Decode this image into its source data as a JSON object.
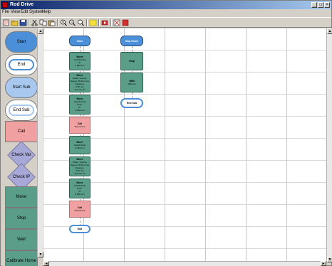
{
  "window": {
    "title": "Rod Drive"
  },
  "menu": [
    "File",
    "View",
    "Edit",
    "System",
    "Help"
  ],
  "toolbar": {
    "buttons": [
      "new-icon",
      "open-icon",
      "save-icon",
      "cut-icon",
      "copy-icon",
      "paste-icon",
      "zoom-in-icon",
      "zoom-out-icon",
      "zoom-fit-icon",
      "highlight-icon",
      "run-icon",
      "stop-icon"
    ]
  },
  "palette": {
    "items": [
      {
        "label": "Start",
        "shape": "lozenge",
        "fill": "#4b8fd8"
      },
      {
        "label": "End",
        "shape": "lozenge",
        "fill": "#ffffff"
      },
      {
        "label": "Start Sub",
        "shape": "lozenge",
        "fill": "#a8c8f0"
      },
      {
        "label": "End Sub",
        "shape": "lozenge",
        "fill": "#ffffff"
      },
      {
        "label": "Call",
        "shape": "rect",
        "fill": "#f0a0a0"
      },
      {
        "label": "Check Var",
        "shape": "diamond",
        "fill": "#a8a8d8"
      },
      {
        "label": "Check IP",
        "shape": "diamond",
        "fill": "#a8a8d8"
      },
      {
        "label": "Move",
        "shape": "rect",
        "fill": "#5a9e8a"
      },
      {
        "label": "Stop",
        "shape": "rect",
        "fill": "#5a9e8a"
      },
      {
        "label": "Wait",
        "shape": "rect",
        "fill": "#5a9e8a"
      },
      {
        "label": "Calibrate Home",
        "shape": "rect",
        "fill": "#5a9e8a"
      }
    ]
  },
  "flow1": [
    {
      "kind": "cap",
      "title": "Start",
      "lines": []
    },
    {
      "kind": "rect",
      "title": "Move",
      "lines": [
        "Axis/Acc/Vel",
        "To:",
        "0.000 mm"
      ]
    },
    {
      "kind": "rect",
      "title": "Move",
      "lines": [
        "Mode: Velocity",
        "Speed: 25.00 mm/s",
        "Distance:",
        "0.00 mm",
        "Timeout: 5s"
      ]
    },
    {
      "kind": "rect",
      "title": "Move",
      "lines": [
        "Axis/Acc/Vel",
        "From:",
        "To:",
        "0.000 mm"
      ]
    },
    {
      "kind": "call",
      "title": "Call",
      "lines": [
        "Step Home"
      ]
    },
    {
      "kind": "rect",
      "title": "Move",
      "lines": [
        "Axis/Acc/Vel",
        "0.000 mm"
      ]
    },
    {
      "kind": "rect",
      "title": "Move",
      "lines": [
        "Mode: Velocity",
        "Speed: 25.00 mm/s",
        "Distance:",
        "0.00 mm",
        "Timeout: 5s"
      ]
    },
    {
      "kind": "rect",
      "title": "Move",
      "lines": [
        "Axis/Acc/Vel",
        "From:",
        "To:",
        "0.000 mm"
      ]
    },
    {
      "kind": "call",
      "title": "Call",
      "lines": [
        "Step Home"
      ]
    },
    {
      "kind": "endcap",
      "title": "End",
      "lines": []
    }
  ],
  "flow2": [
    {
      "kind": "cap",
      "title": "Step Home",
      "lines": []
    },
    {
      "kind": "rect",
      "title": "Stop",
      "lines": []
    },
    {
      "kind": "rect",
      "title": "Wait",
      "lines": [
        "1000 ms"
      ]
    },
    {
      "kind": "endcap",
      "title": "End Sub",
      "lines": []
    }
  ]
}
